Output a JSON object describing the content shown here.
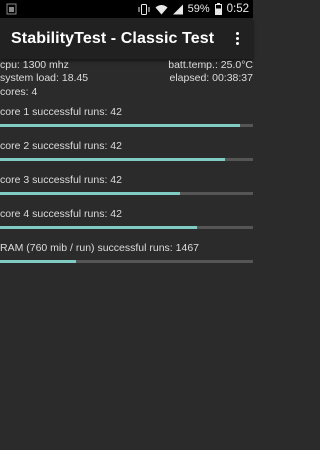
{
  "status_bar": {
    "battery_percent": "59%",
    "time": "0:52",
    "icons": [
      "android-debug-icon",
      "vibrate-icon",
      "wifi-icon",
      "signal-icon",
      "battery-icon"
    ]
  },
  "app_bar": {
    "title": "StabilityTest - Classic Test",
    "menu_icon": "overflow-menu-icon"
  },
  "info": {
    "cpu": "cpu: 1300 mhz",
    "batt_temp": "batt.temp.: 25.0°C",
    "system_load": "system load: 18.45",
    "elapsed": "elapsed: 00:38:37",
    "cores": "cores: 4"
  },
  "tests": [
    {
      "label": "core 1 successful runs: 42",
      "progress": 0.95
    },
    {
      "label": "core 2 successful runs: 42",
      "progress": 0.89
    },
    {
      "label": "core 3 successful runs: 42",
      "progress": 0.71
    },
    {
      "label": "core 4 successful runs: 42",
      "progress": 0.78
    },
    {
      "label": "RAM (760 mib / run) successful runs: 1467",
      "progress": 0.3
    }
  ],
  "colors": {
    "background": "#2b2b2b",
    "app_bar": "#212121",
    "progress_fill": "#80cbc4",
    "progress_track": "#555555"
  }
}
